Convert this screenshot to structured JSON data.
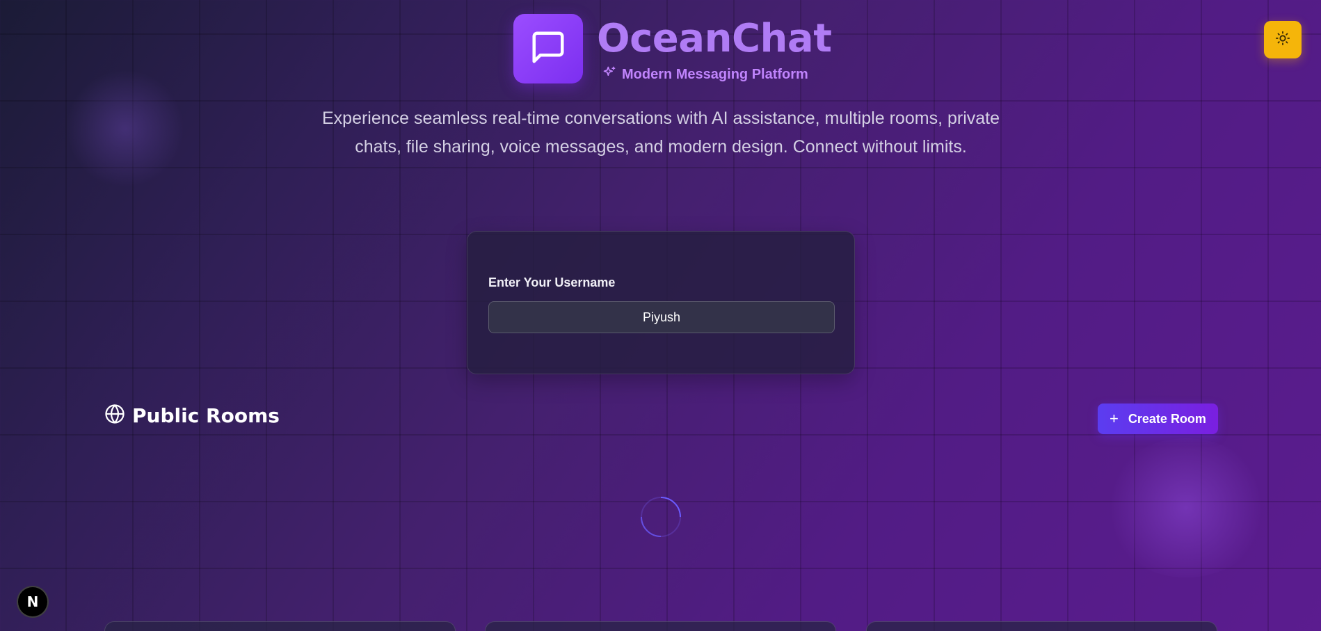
{
  "brand": {
    "title": "OceanChat",
    "subtitle": "Modern Messaging Platform",
    "logo_icon": "message-square-icon",
    "subtitle_icon": "sparkles-icon"
  },
  "theme_toggle": {
    "icon": "sun-icon",
    "color": "#f5b50a"
  },
  "tagline": "Experience seamless real-time conversations with AI assistance, multiple rooms, private chats, file sharing, voice messages, and modern design. Connect without limits.",
  "username_form": {
    "label": "Enter Your Username",
    "value": "Piyush"
  },
  "public_rooms": {
    "title": "Public Rooms",
    "icon": "globe-icon",
    "create_button_label": "Create Room",
    "create_button_icon": "plus-icon",
    "loading": true,
    "room_cards_visible": 3
  },
  "dev_badge": {
    "letter": "N"
  },
  "colors": {
    "accent_purple": "#9b4dff",
    "brand_text": "#b07cf5",
    "subtitle_text": "#c084fc",
    "button_gradient_start": "#5b3df0",
    "button_gradient_end": "#7a1fe0"
  }
}
